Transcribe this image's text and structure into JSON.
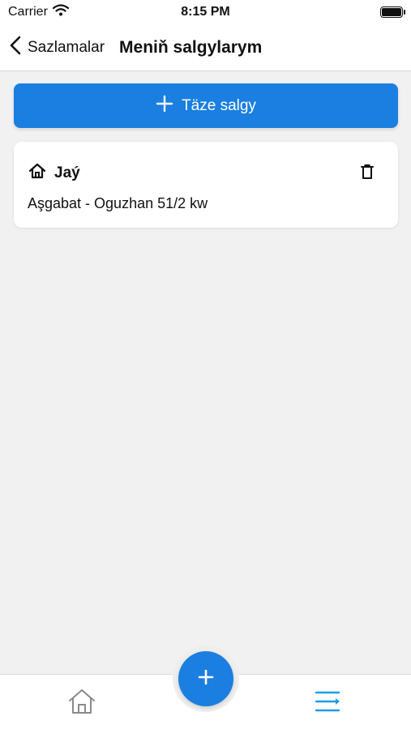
{
  "status_bar": {
    "carrier": "Carrier",
    "time": "8:15 PM",
    "icons": [
      "wifi-icon",
      "battery-icon"
    ]
  },
  "nav_bar": {
    "back_label": "Sazlamalar",
    "title": "Meniň salgylarym",
    "icons": [
      "chevron-left-icon"
    ]
  },
  "add_address_button": {
    "label": "Täze salgy",
    "icon": "plus-icon",
    "color": "#1a7fe0"
  },
  "addresses": [
    {
      "name": "Jaý",
      "address": "Aşgabat - Oguzhan 51/2 kw",
      "icon": "home-icon",
      "action_icon": "trash-icon"
    }
  ],
  "tab_bar": {
    "items": [
      {
        "icon": "home-icon",
        "active": false
      },
      {
        "icon": "plus-icon",
        "active": false
      },
      {
        "icon": "list-icon",
        "active": true
      }
    ],
    "active_color": "#1a9ee6",
    "fab_color": "#1a7fe0"
  },
  "colors": {
    "background": "#f1f1f1",
    "accent": "#1a7fe0"
  }
}
